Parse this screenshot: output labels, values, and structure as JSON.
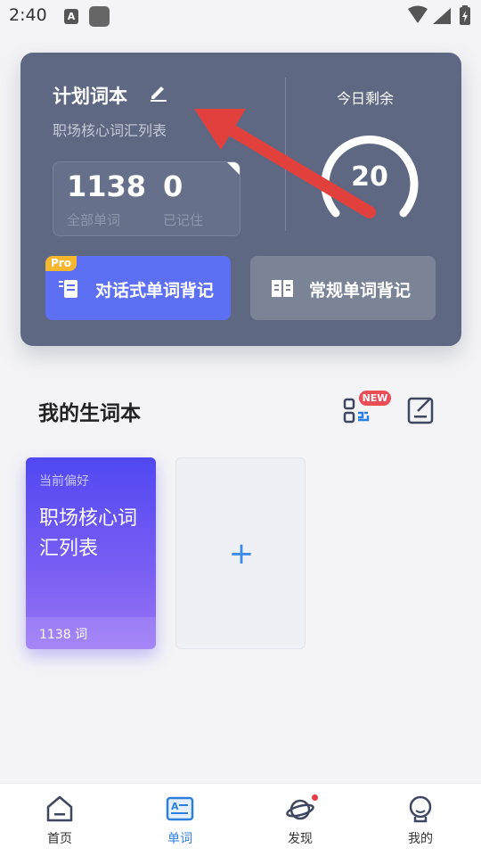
{
  "status_bar": {
    "time": "2:40",
    "a_icon_letter": "A"
  },
  "plan_card": {
    "title": "计划词本",
    "subtitle": "职场核心词汇列表",
    "total_count": "1138",
    "total_label": "全部单词",
    "memorized_count": "0",
    "memorized_label": "已记住",
    "remaining_label": "今日剩余",
    "remaining_count": "20",
    "pro_badge": "Pro",
    "dialog_button_label": "对话式单词背记",
    "regular_button_label": "常规单词背记"
  },
  "vocab_section": {
    "title": "我的生词本",
    "new_badge": "NEW",
    "book": {
      "preference_label": "当前偏好",
      "name": "职场核心词汇列表",
      "count": "1138 词"
    },
    "add_symbol": "+"
  },
  "bottom_nav": {
    "items": [
      {
        "label": "首页",
        "icon": "home-icon",
        "active": false
      },
      {
        "label": "单词",
        "icon": "word-card-icon",
        "active": true
      },
      {
        "label": "发现",
        "icon": "planet-icon",
        "active": false
      },
      {
        "label": "我的",
        "icon": "profile-icon",
        "active": false
      }
    ]
  },
  "colors": {
    "card_bg": "#5e6882",
    "primary_button": "#5d6ff3",
    "pro_badge": "#f6b62d",
    "new_badge": "#ea4d55",
    "active_nav": "#2c7fe0",
    "arrow": "#e2403d"
  }
}
